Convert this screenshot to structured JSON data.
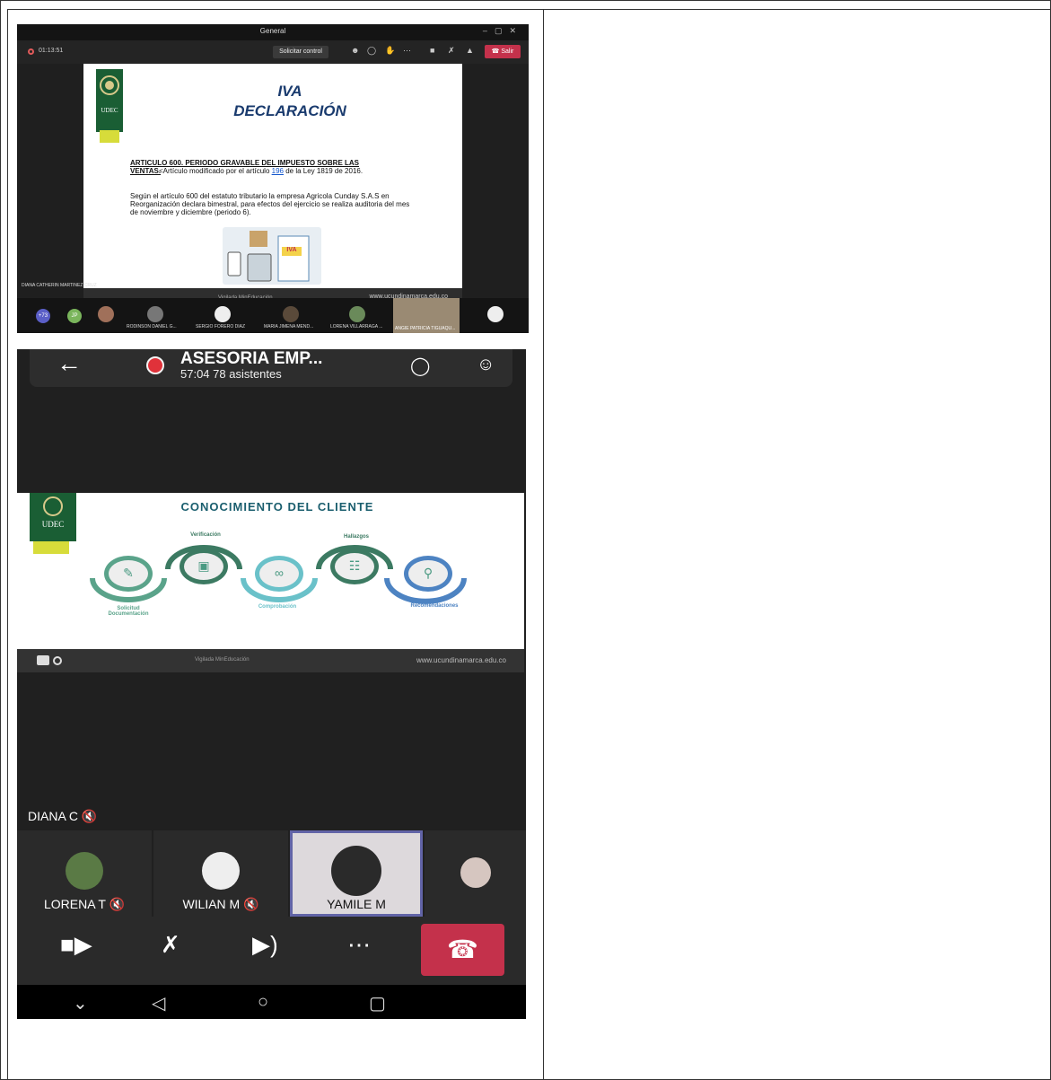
{
  "desktop": {
    "window_title": "General",
    "window_controls": [
      "–",
      "▢",
      "✕"
    ],
    "timer": "01:13:51",
    "request_control": "Solicitar control",
    "leave": "Salir",
    "slide": {
      "logo": "UDEC",
      "title_line1": "IVA",
      "title_line2": "DECLARACIÓN",
      "article_title": "ARTICULO 600. PERIODO GRAVABLE DEL IMPUESTO SOBRE LAS",
      "article_title_2": "VENTAS.",
      "article_note_pre": "<Artículo modificado por el artículo ",
      "article_link": "196",
      "article_note_post": " de la Ley 1819 de 2016.",
      "body": "Según el artículo 600 del estatuto tributario la empresa Agricola Cunday S.A.S en Reorganización declara bimestral, para efectos del ejercicio se realiza auditoria del mes de noviembre y diciembre (periodo 6).",
      "illustration_tag": "IVA",
      "footer_mid": "Vigilada MinEducación",
      "footer_right": "www.ucundinamarca.edu.co"
    },
    "presenter": "DIANA CATHERIN MARTINEZ CRUZ",
    "participants": [
      {
        "badge": "+73"
      },
      {
        "badge": "JP"
      },
      {
        "name": "RODINSON DANIEL G..."
      },
      {
        "name": "SERGIO FORERO DIAZ"
      },
      {
        "name": "MARIA JIMENA MEND..."
      },
      {
        "name": "LORENA VILLARRAGA ..."
      },
      {
        "name": "ANGIE PATRICIA TIGUAQU..."
      }
    ],
    "colors": {
      "leave": "#c4314b",
      "record": "#e05a5a"
    }
  },
  "mobile": {
    "title": "ASESORIA EMP...",
    "subtitle": "57:04  78 asistentes",
    "slide": {
      "logo": "UDEC",
      "title": "CONOCIMIENTO DEL CLIENTE",
      "labels": {
        "verificacion": "Verificación",
        "hallazgos": "Hallazgos",
        "solicitud": "Solicitud\nDocumentación",
        "comprobacion": "Comprobación",
        "recomendaciones": "Recomendaciones"
      },
      "footer_mid": "Vigilada MinEducación",
      "footer_right": "www.ucundinamarca.edu.co"
    },
    "presenter_label": "DIANA C",
    "tiles": [
      {
        "name": "LORENA T"
      },
      {
        "name": "WILIAN M"
      },
      {
        "name": "YAMILE M"
      },
      {
        "name": ""
      }
    ],
    "colors": {
      "hangup": "#c4314b",
      "active_border": "#6264a7",
      "record": "#e0323a"
    }
  }
}
